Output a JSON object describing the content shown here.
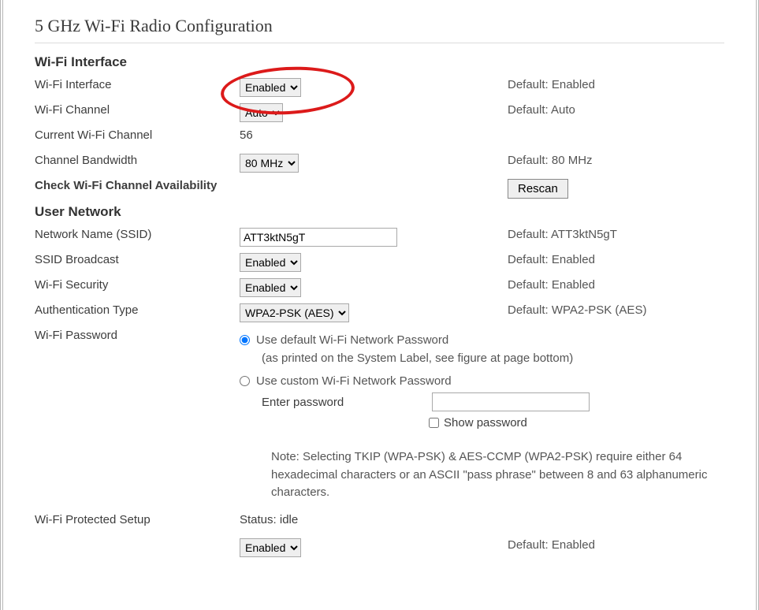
{
  "page": {
    "title": "5 GHz Wi-Fi Radio Configuration"
  },
  "sections": {
    "interface": {
      "title": "Wi-Fi Interface",
      "wifi_interface_label": "Wi-Fi Interface",
      "wifi_interface_value": "Enabled",
      "wifi_interface_default": "Default: Enabled",
      "wifi_channel_label": "Wi-Fi Channel",
      "wifi_channel_value": "Auto",
      "wifi_channel_default": "Default: Auto",
      "current_channel_label": "Current Wi-Fi Channel",
      "current_channel_value": "56",
      "channel_bw_label": "Channel Bandwidth",
      "channel_bw_value": "80 MHz",
      "channel_bw_default": "Default: 80 MHz",
      "check_avail_label": "Check Wi-Fi Channel Availability",
      "rescan_label": "Rescan"
    },
    "user_network": {
      "title": "User Network",
      "ssid_label": "Network Name (SSID)",
      "ssid_value": "ATT3ktN5gT",
      "ssid_default": "Default: ATT3ktN5gT",
      "broadcast_label": "SSID Broadcast",
      "broadcast_value": "Enabled",
      "broadcast_default": "Default: Enabled",
      "security_label": "Wi-Fi Security",
      "security_value": "Enabled",
      "security_default": "Default: Enabled",
      "auth_label": "Authentication Type",
      "auth_value": "WPA2-PSK (AES)",
      "auth_default": "Default: WPA2-PSK (AES)",
      "password_label": "Wi-Fi Password",
      "pw_default_option": "Use default Wi-Fi Network Password",
      "pw_default_note": "(as printed on the System Label, see figure at page bottom)",
      "pw_custom_option": "Use custom Wi-Fi Network Password",
      "pw_enter_label": "Enter password",
      "pw_show_label": "Show password",
      "note_text": "Note: Selecting TKIP (WPA-PSK) & AES-CCMP (WPA2-PSK) require either 64 hexadecimal characters or an ASCII \"pass phrase\" between 8 and 63 alphanumeric characters.",
      "wps_label": "Wi-Fi Protected Setup",
      "wps_status": "Status: idle",
      "wps_value": "Enabled",
      "wps_default": "Default: Enabled"
    }
  }
}
